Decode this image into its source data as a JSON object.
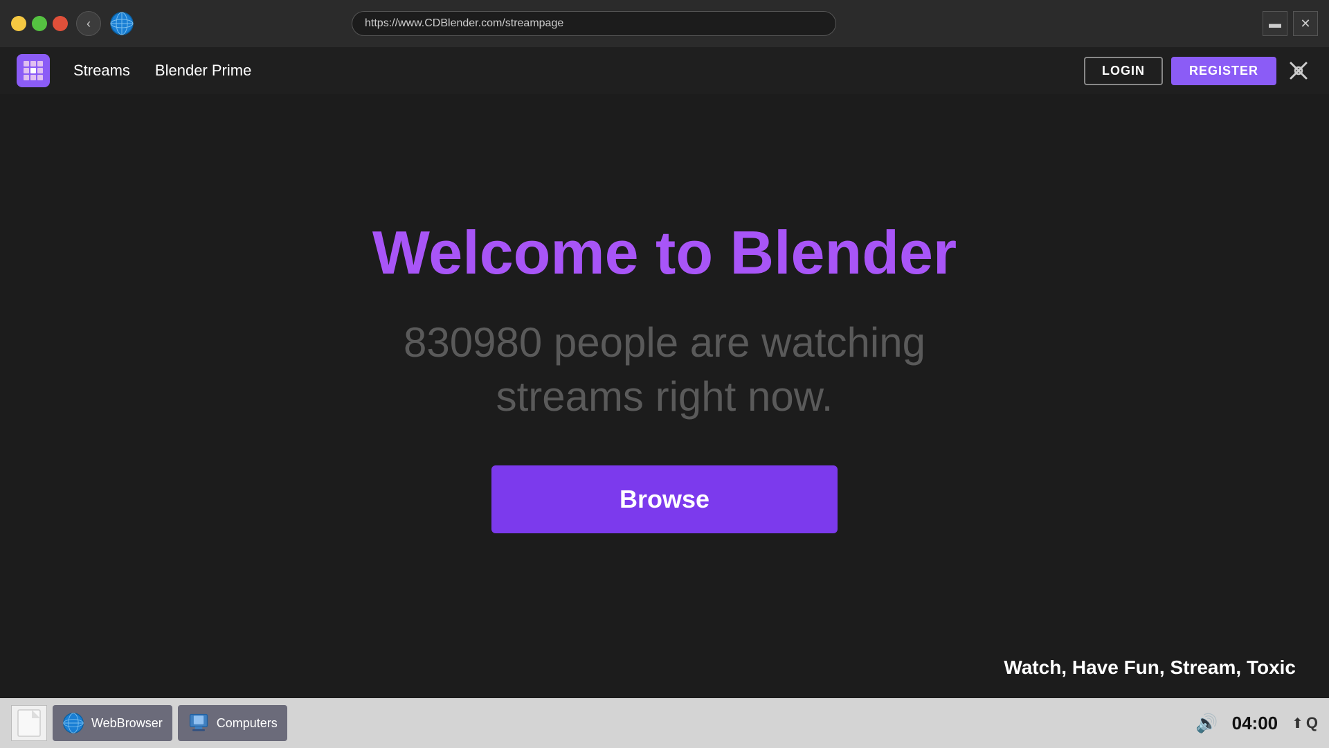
{
  "browser": {
    "url": "https://www.CDBlender.com/streampage",
    "back_button_label": "‹",
    "minimize_icon": "▬",
    "close_icon": "✕"
  },
  "site": {
    "nav": {
      "streams_label": "Streams",
      "blender_prime_label": "Blender Prime",
      "login_label": "LOGIN",
      "register_label": "REGISTER"
    },
    "hero": {
      "title": "Welcome to Blender",
      "subtitle_count": "830980 people are watching\nstreams right now.",
      "browse_label": "Browse",
      "tagline": "Watch, Have Fun, Stream, Toxic"
    }
  },
  "taskbar": {
    "webbrowser_label": "WebBrowser",
    "computers_label": "Computers",
    "time": "04:00"
  }
}
